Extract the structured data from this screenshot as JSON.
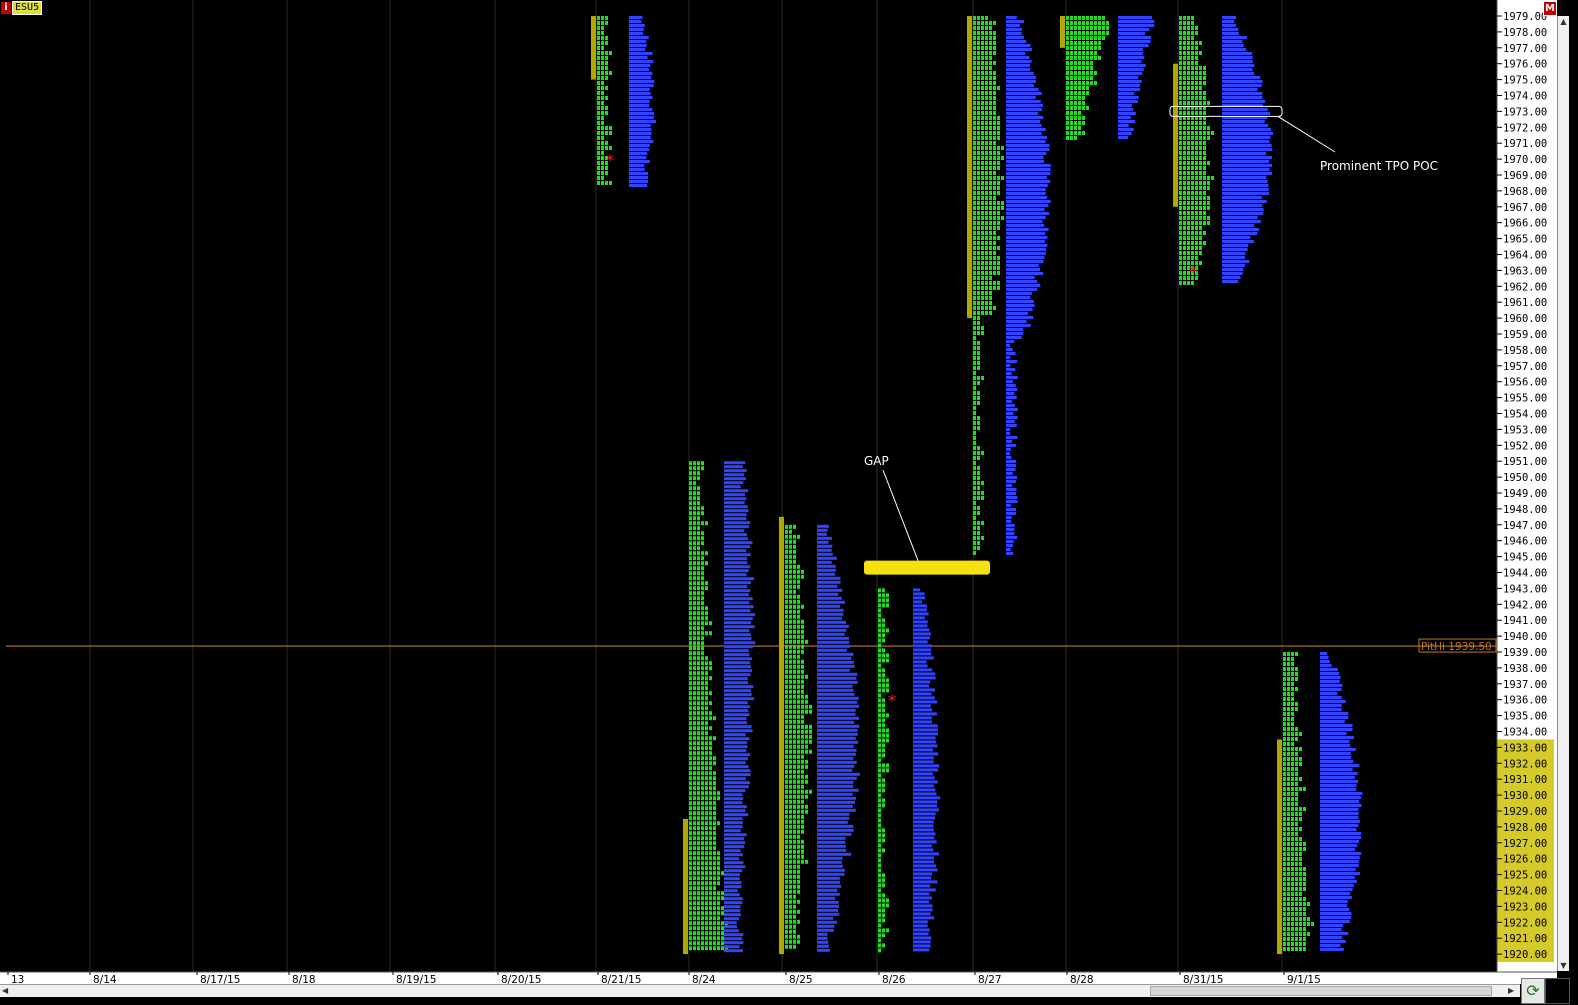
{
  "symbol": {
    "info_icon": "i",
    "name": "ESU5"
  },
  "m_button": "M",
  "y_axis": {
    "min": 1920,
    "max": 1979,
    "step": 1,
    "highlight_range": [
      1920,
      1933
    ]
  },
  "x_axis": {
    "labels": [
      "13",
      "8/14",
      "8/17/15",
      "8/18",
      "8/19/15",
      "8/20/15",
      "8/21/15",
      "8/24",
      "8/25",
      "8/26",
      "8/27",
      "8/28",
      "8/31/15",
      "9/1/15"
    ]
  },
  "pit_line": {
    "label": "PitHi 1939.50",
    "price": 1939.5
  },
  "annotations": {
    "gap_label": "GAP",
    "poc_label": "Prominent TPO POC"
  },
  "colors": {
    "tpo_green": "#22dd22",
    "volume_blue": "#3344ff",
    "value_area_olive": "#b0a800",
    "gap_yellow": "#f7e010",
    "pit_line": "#c07a20",
    "axis_highlight": "#d6ca2a"
  },
  "chart_data": {
    "type": "bar",
    "title": "",
    "xlabel": "",
    "ylabel": "",
    "ylim": [
      1920,
      1979
    ],
    "categories": [
      "8/21/15",
      "8/24",
      "8/25",
      "8/26",
      "8/27",
      "8/28",
      "8/31/15",
      "9/1/15"
    ],
    "sessions": [
      {
        "date": "8/21/15",
        "low": 1968,
        "high": 1979
      },
      {
        "date": "8/24",
        "low": 1920,
        "high": 1951
      },
      {
        "date": "8/25",
        "low": 1920,
        "high": 1947
      },
      {
        "date": "8/26",
        "low": 1920,
        "high": 1943
      },
      {
        "date": "8/27",
        "low": 1945,
        "high": 1979
      },
      {
        "date": "8/28",
        "low": 1971,
        "high": 1979
      },
      {
        "date": "8/31/15",
        "low": 1962,
        "high": 1979
      },
      {
        "date": "9/1/15",
        "low": 1920,
        "high": 1939
      }
    ],
    "gap": [
      1943,
      1945
    ],
    "poc_price": 1973,
    "grid": true
  }
}
